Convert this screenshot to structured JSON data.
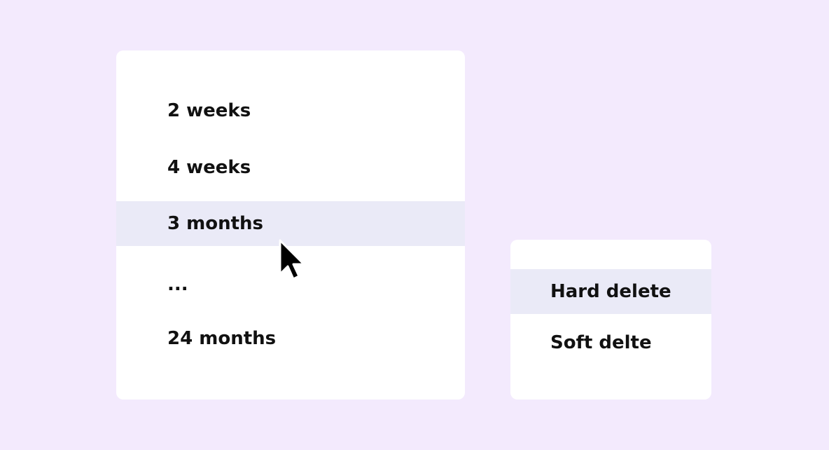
{
  "retention_menu": {
    "items": [
      {
        "label": "2 weeks",
        "selected": false
      },
      {
        "label": "4 weeks",
        "selected": false
      },
      {
        "label": "3 months",
        "selected": true
      },
      {
        "label": "...",
        "selected": false
      },
      {
        "label": "24 months",
        "selected": false
      }
    ]
  },
  "delete_menu": {
    "items": [
      {
        "label": "Hard delete",
        "selected": true
      },
      {
        "label": "Soft delte",
        "selected": false
      }
    ]
  },
  "colors": {
    "background": "#f3eafd",
    "panel": "#ffffff",
    "selected_row": "#eaeaf7",
    "text": "#111111"
  },
  "cursor_icon": "mouse-pointer-arrow"
}
